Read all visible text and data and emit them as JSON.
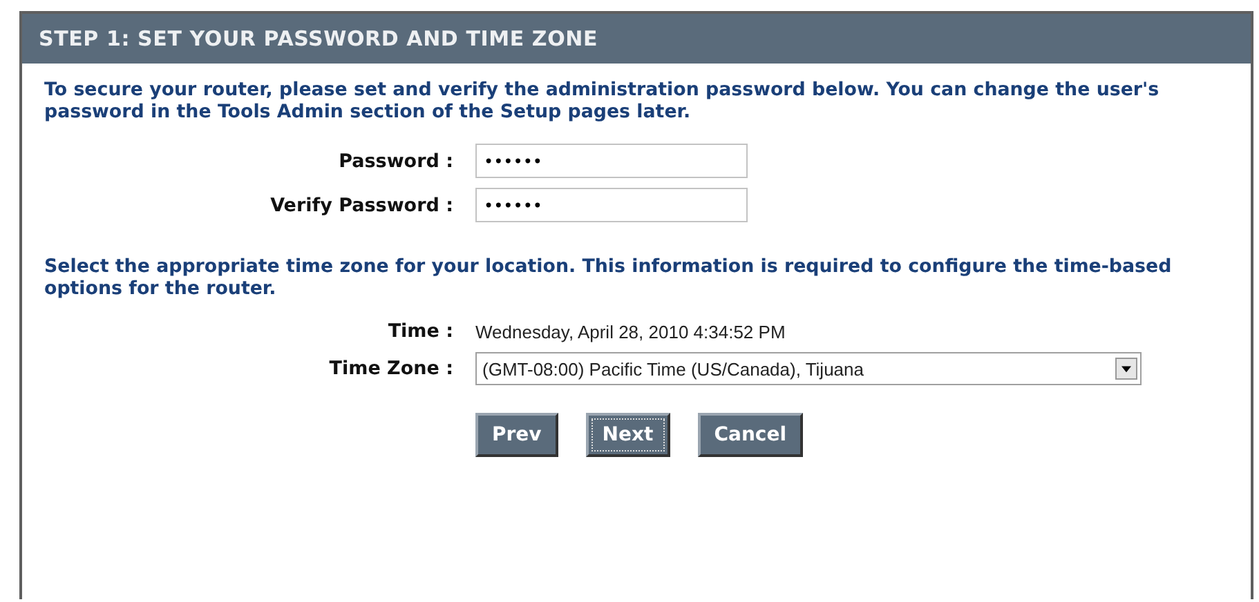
{
  "panel": {
    "title": "STEP 1: SET YOUR PASSWORD AND TIME ZONE"
  },
  "password_intro": "To secure your router, please set and verify the administration password below. You can change the user's password in the Tools Admin section of the Setup pages later.",
  "password_fields": [
    {
      "label": "Password :",
      "value": "••••••"
    },
    {
      "label": "Verify Password :",
      "value": "••••••"
    }
  ],
  "timezone_intro": "Select the appropriate time zone for your location. This information is required to configure the time-based options for the router.",
  "time": {
    "label": "Time :",
    "value": "Wednesday, April 28, 2010 4:34:52 PM"
  },
  "time_zone": {
    "label": "Time Zone :",
    "value": "(GMT-08:00) Pacific Time (US/Canada), Tijuana"
  },
  "buttons": [
    {
      "label": "Prev",
      "focused": false
    },
    {
      "label": "Next",
      "focused": true
    },
    {
      "label": "Cancel",
      "focused": false
    }
  ]
}
